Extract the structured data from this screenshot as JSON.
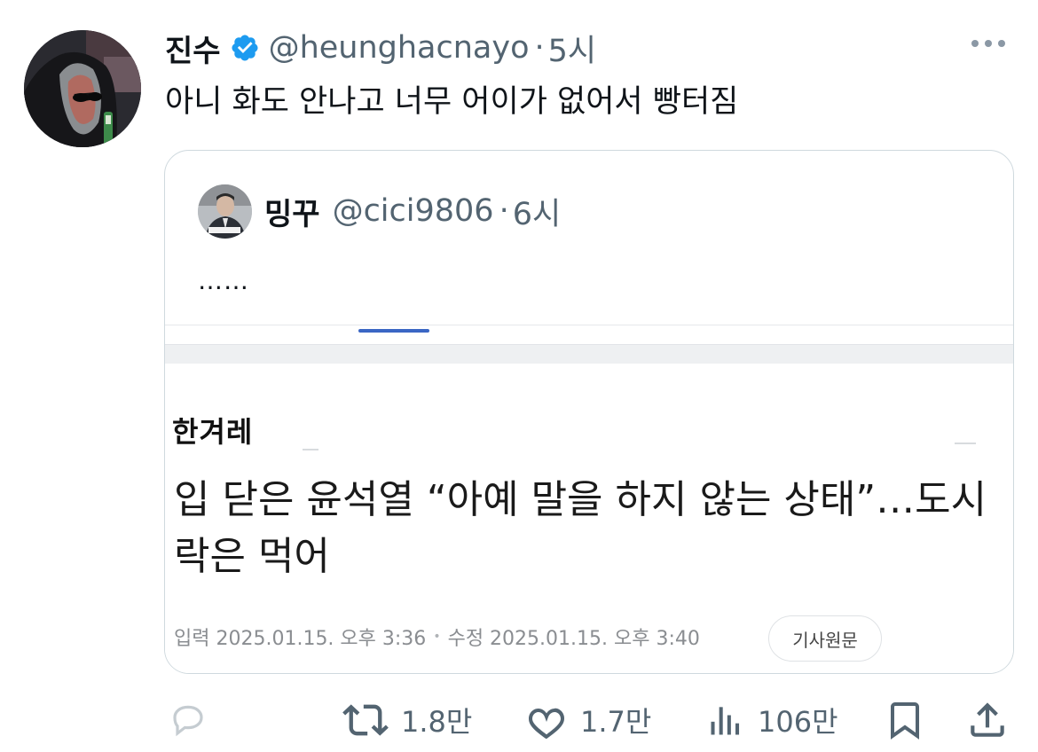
{
  "tweet": {
    "author_name": "진수",
    "handle": "@heunghacnayo",
    "separator": "·",
    "time": "5시",
    "text": "아니 화도 안나고 너무 어이가 없어서 빵터짐"
  },
  "quoted": {
    "author_name": "밍꾸",
    "handle": "@cici9806",
    "separator": "·",
    "time": "6시",
    "text": "……",
    "article": {
      "publisher": "한겨레",
      "headline": "입 닫은 윤석열 “아예 말을 하지 않는 상태”…도시락은 먹어",
      "published": "입력 2025.01.15. 오후 3:36",
      "meta_separator": "•",
      "modified": "수정 2025.01.15. 오후 3:40",
      "original_button": "기사원문"
    }
  },
  "actions": {
    "reply_icon": "comment-icon",
    "retweet_icon": "retweet-icon",
    "retweets": "1.8만",
    "like_icon": "heart-icon",
    "likes": "1.7만",
    "views_icon": "bar-chart-icon",
    "views": "106만",
    "bookmark_icon": "bookmark-icon",
    "share_icon": "share-icon"
  },
  "colors": {
    "text_primary": "#0f1419",
    "text_secondary": "#536471",
    "verified_blue": "#1d9bf0",
    "border": "#cfd9de"
  }
}
